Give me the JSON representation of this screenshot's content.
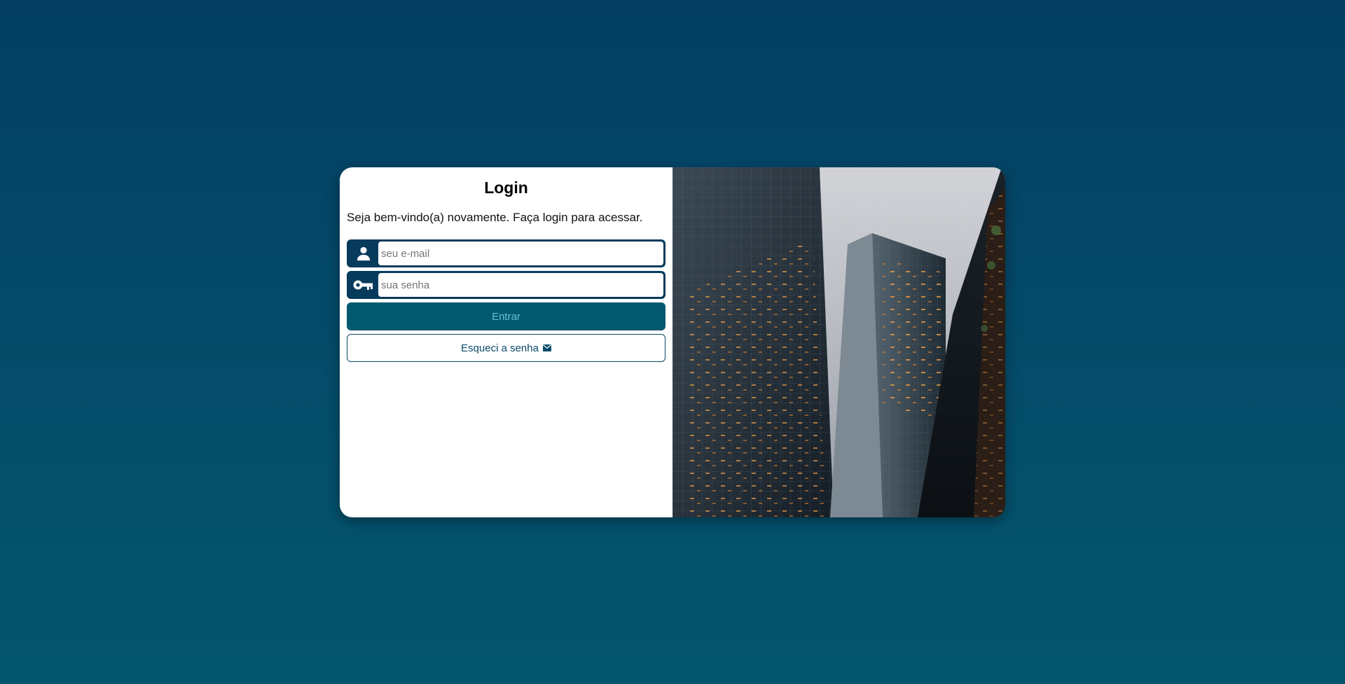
{
  "login": {
    "title": "Login",
    "welcome": "Seja bem-vindo(a) novamente. Faça login para acessar.",
    "email": {
      "placeholder": "seu e-mail",
      "value": "",
      "icon": "user-icon"
    },
    "password": {
      "placeholder": "sua senha",
      "value": "",
      "icon": "key-icon"
    },
    "submit_label": "Entrar",
    "forgot_label": "Esqueci a senha",
    "forgot_icon": "mail-icon"
  },
  "colors": {
    "background_top": "#043f63",
    "background_bottom": "#04566e",
    "field_frame": "#073b5c",
    "primary_button": "#03596e",
    "primary_button_text": "#5fc4d4"
  }
}
